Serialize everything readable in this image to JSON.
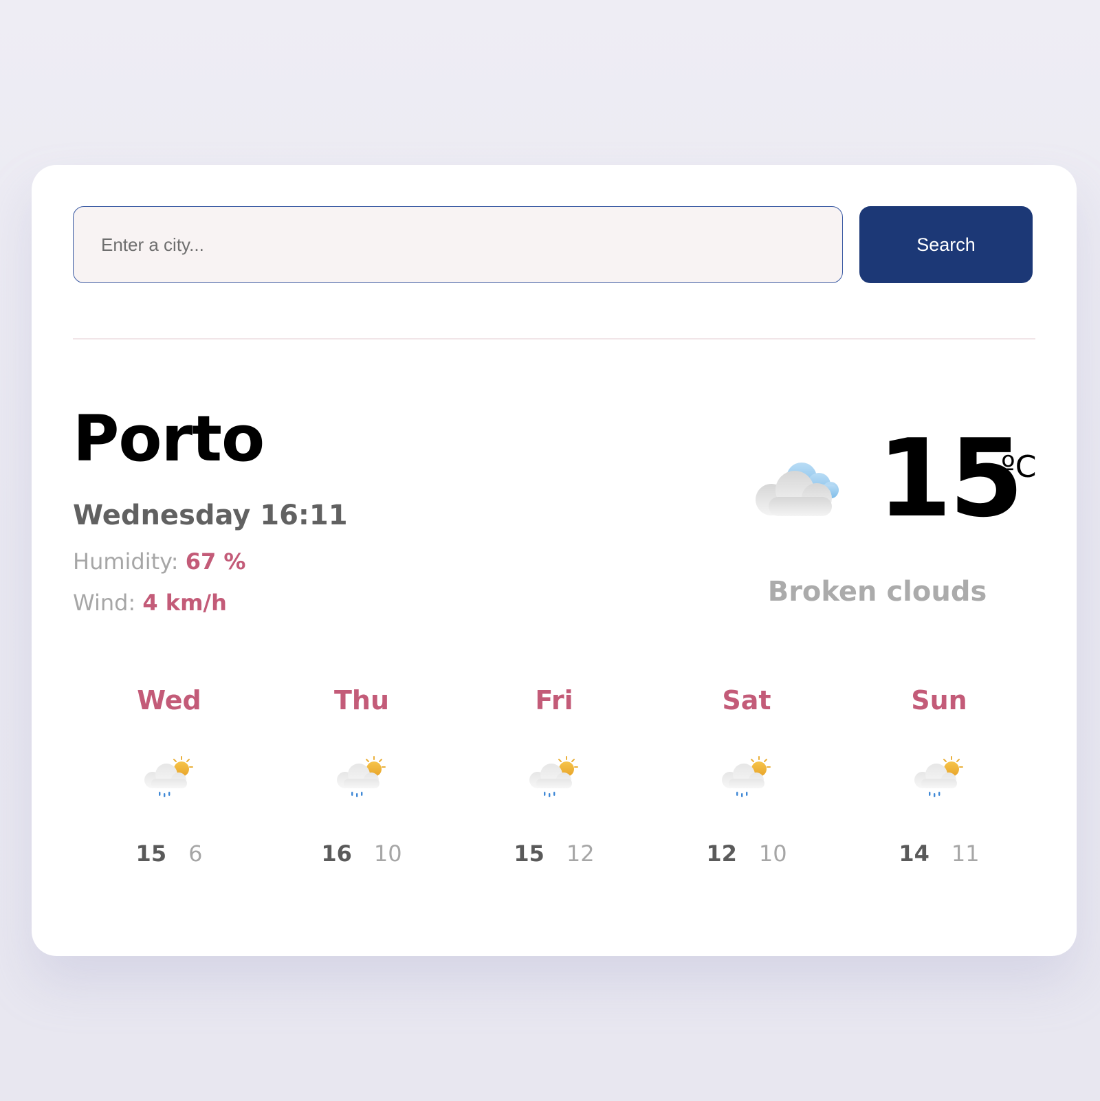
{
  "search": {
    "placeholder": "Enter a city...",
    "button_label": "Search"
  },
  "current": {
    "city": "Porto",
    "datetime": "Wednesday 16:11",
    "humidity_label": "Humidity:",
    "humidity_value": "67 %",
    "wind_label": "Wind:",
    "wind_value": "4 km/h",
    "temperature": "15",
    "unit": "ºC",
    "description": "Broken clouds",
    "icon": "broken-clouds-icon"
  },
  "forecast": [
    {
      "day": "Wed",
      "max": "15",
      "min": "6",
      "icon": "rain-sun-cloud-icon"
    },
    {
      "day": "Thu",
      "max": "16",
      "min": "10",
      "icon": "rain-sun-cloud-icon"
    },
    {
      "day": "Fri",
      "max": "15",
      "min": "12",
      "icon": "rain-sun-cloud-icon"
    },
    {
      "day": "Sat",
      "max": "12",
      "min": "10",
      "icon": "rain-sun-cloud-icon"
    },
    {
      "day": "Sun",
      "max": "14",
      "min": "11",
      "icon": "rain-sun-cloud-icon"
    }
  ],
  "colors": {
    "accent": "#c35b78",
    "button": "#1c3876",
    "input_border": "#3a5aa3",
    "input_bg": "#f8f3f3"
  }
}
